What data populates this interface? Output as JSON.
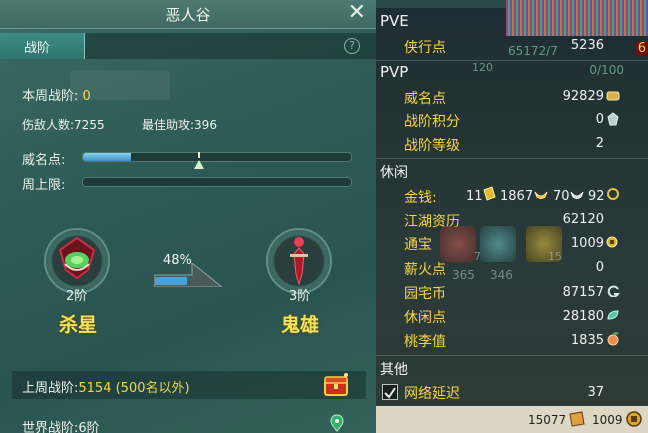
{
  "window": {
    "title": "恶人谷"
  },
  "tabs": [
    {
      "label": "战阶"
    }
  ],
  "help": "?",
  "close": "✕",
  "weekly_rank": {
    "label": "本周战阶:",
    "value": "0"
  },
  "stats": {
    "kills_label": "伤敌人数:",
    "kills": "7255",
    "assists_label": "最佳助攻:",
    "assists": "396"
  },
  "prestige": {
    "label": "威名点:",
    "fill_fraction": 0.18
  },
  "week_limit": {
    "label": "周上限:",
    "fill_fraction": 0.0
  },
  "current_rank": {
    "level": "2阶",
    "name": "杀星"
  },
  "next_rank": {
    "level": "3阶",
    "name": "鬼雄"
  },
  "rank_progress": {
    "percent_text": "48%",
    "fraction": 0.48
  },
  "last_week": {
    "label": "上周战阶:",
    "value": "5154 (500名以外)"
  },
  "world": {
    "label": "世界战阶:",
    "value": "6阶"
  },
  "hud": {
    "left_num": "65172/7",
    "right_num": "0/100",
    "level_num": "120",
    "top_val": "6"
  },
  "right": {
    "pve": {
      "title": "PVE",
      "rows": [
        {
          "label": "侠行点",
          "value": "5236"
        }
      ]
    },
    "pvp": {
      "title": "PVP",
      "rows": [
        {
          "label": "威名点",
          "value": "92829"
        },
        {
          "label": "战阶积分",
          "value": "0"
        },
        {
          "label": "战阶等级",
          "value": "2"
        }
      ]
    },
    "leisure": {
      "title": "休闲",
      "money": {
        "label": "金钱:",
        "brick": "11",
        "gold": "1867",
        "silver": "70",
        "copper": "92"
      },
      "rows": [
        {
          "label": "江湖资历",
          "value": "62120"
        },
        {
          "label": "通宝",
          "value": "1009"
        },
        {
          "label": "薪火点",
          "value": "0"
        },
        {
          "label": "园宅币",
          "value": "87157"
        },
        {
          "label": "休闲点",
          "value": "28180"
        },
        {
          "label": "桃李值",
          "value": "1835"
        }
      ],
      "faded_nums": [
        "365",
        "346",
        "7",
        "15"
      ]
    },
    "other": {
      "title": "其他",
      "latency": {
        "label": "网络延迟",
        "value": "37",
        "checked": true
      }
    },
    "bottom": {
      "coins": "15077",
      "tongbao": "1009"
    }
  },
  "colors": {
    "accent_gold": "#f2d84a",
    "panel_teal": "#2d5a55",
    "bar_blue": "#4aa0d8"
  }
}
